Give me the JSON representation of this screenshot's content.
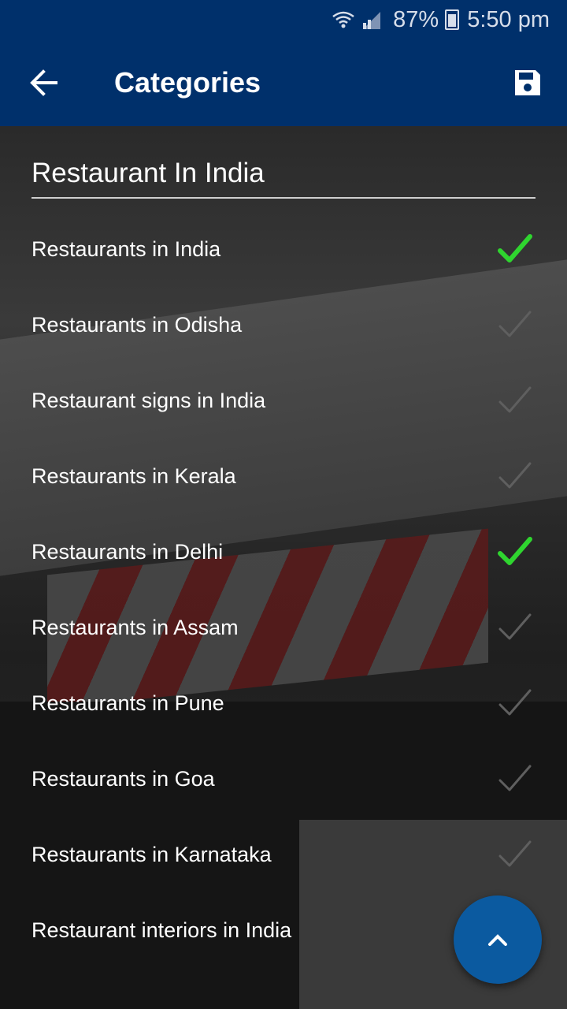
{
  "status_bar": {
    "battery_percent": "87%",
    "time": "5:50 pm",
    "icons": [
      "wifi-icon",
      "signal-icon",
      "battery-icon"
    ]
  },
  "app_bar": {
    "title": "Categories",
    "back_icon": "arrow-back-icon",
    "save_icon": "save-icon"
  },
  "colors": {
    "app_bar_bg": "#00306b",
    "check_selected": "#2fd52f",
    "check_unselected": "#5f5f5f",
    "fab_bg": "#0b5aa0"
  },
  "category_header": "Restaurant In India",
  "items": [
    {
      "label": "Restaurants in India",
      "checked": true
    },
    {
      "label": "Restaurants in Odisha",
      "checked": false
    },
    {
      "label": "Restaurant signs in India",
      "checked": false
    },
    {
      "label": "Restaurants in Kerala",
      "checked": false
    },
    {
      "label": "Restaurants in Delhi",
      "checked": true
    },
    {
      "label": "Restaurants in Assam",
      "checked": false
    },
    {
      "label": "Restaurants in Pune",
      "checked": false
    },
    {
      "label": "Restaurants in Goa",
      "checked": false
    },
    {
      "label": "Restaurants in Karnataka",
      "checked": false
    },
    {
      "label": "Restaurant interiors in India",
      "checked": false
    }
  ],
  "fab": {
    "icon": "chevron-up-icon"
  }
}
